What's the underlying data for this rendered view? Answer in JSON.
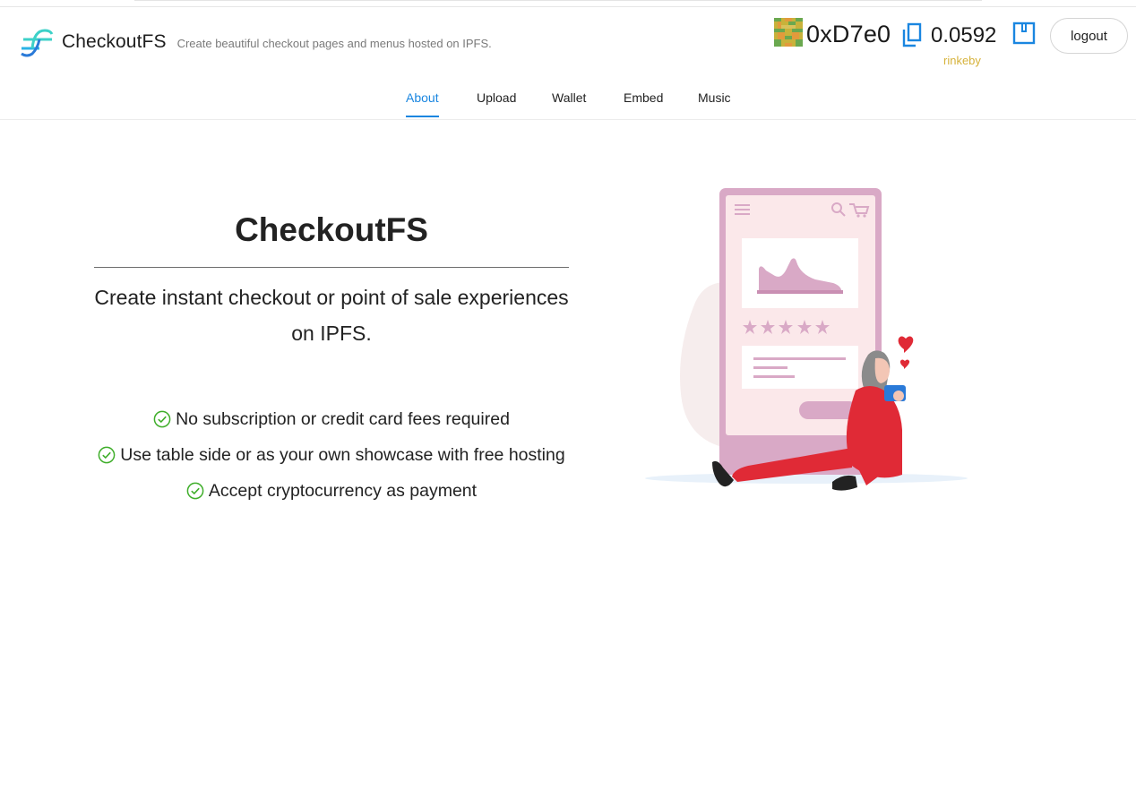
{
  "app": {
    "name": "CheckoutFS",
    "tagline": "Create beautiful checkout pages and menus hosted on IPFS."
  },
  "account": {
    "address": "0xD7e0",
    "balance": "0.0592",
    "network": "rinkeby",
    "logout_label": "logout"
  },
  "nav": {
    "tabs": [
      {
        "label": "About",
        "active": true
      },
      {
        "label": "Upload",
        "active": false
      },
      {
        "label": "Wallet",
        "active": false
      },
      {
        "label": "Embed",
        "active": false
      },
      {
        "label": "Music",
        "active": false
      }
    ]
  },
  "hero": {
    "title": "CheckoutFS",
    "subtitle": "Create instant checkout or point of sale experiences on IPFS.",
    "features": [
      "No subscription or credit card fees required",
      "Use table side or as your own showcase with free hosting",
      "Accept cryptocurrency as payment"
    ]
  },
  "colors": {
    "accent": "#1a86e0",
    "network": "#d6b23a",
    "check": "#3fae2a",
    "illustration_pink": "#d9a9c6",
    "illustration_red": "#e02a36"
  }
}
